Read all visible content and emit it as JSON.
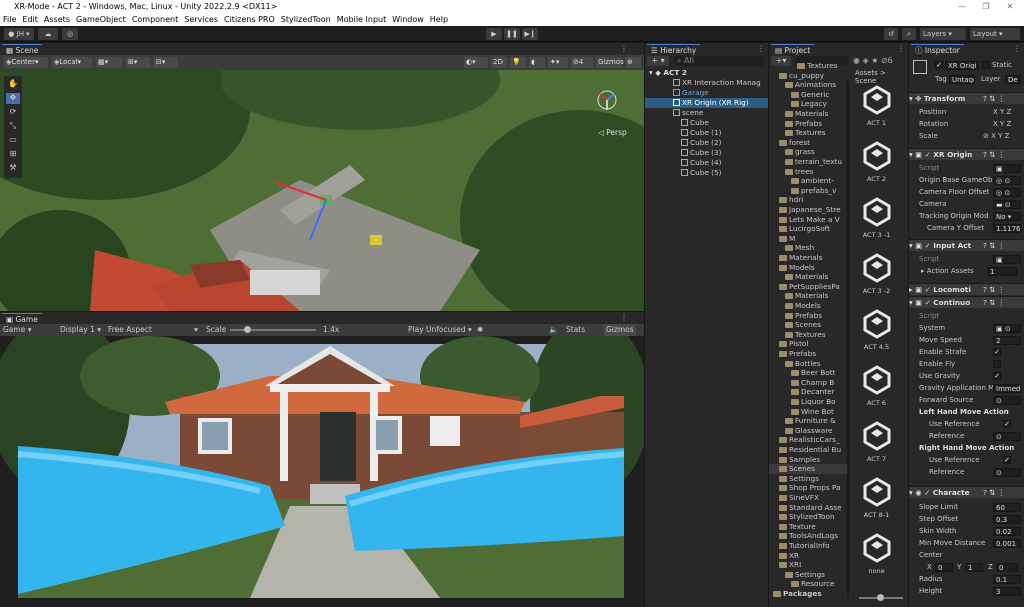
{
  "window": {
    "title": "XR-Mode - ACT 2 - Windows, Mac, Linux - Unity 2022.2.9 <DX11>"
  },
  "menu": [
    "File",
    "Edit",
    "Assets",
    "GameObject",
    "Component",
    "Services",
    "Citizens PRO",
    "StylizedToon",
    "Mobile Input",
    "Window",
    "Help"
  ],
  "toolbar": {
    "account": "JH",
    "layers": "Layers",
    "layout": "Layout"
  },
  "scene": {
    "tab": "Scene",
    "pivot": "Center",
    "space": "Local",
    "mode2d": "2D",
    "persp": "Persp",
    "gizmos": "Gizmos"
  },
  "game": {
    "tab": "Game",
    "view": "Game",
    "display": "Display 1",
    "aspect": "Free Aspect",
    "scale_label": "Scale",
    "scale_value": "1.4x",
    "play_mode": "Play Unfocused",
    "stats": "Stats",
    "gizmos": "Gizmos"
  },
  "hierarchy": {
    "tab": "Hierarchy",
    "search": "All",
    "items": [
      "ACT 2",
      "XR Interaction Manag",
      "Garage",
      "XR Origin (XR Rig)",
      "scene",
      "Cube",
      "Cube (1)",
      "Cube (2)",
      "Cube (3)",
      "Cube (4)",
      "Cube (5)"
    ]
  },
  "project": {
    "tab": "Project",
    "breadcrumb": "Assets > Scene",
    "tree": [
      "Textures",
      "cu_puppy",
      "Animations",
      "Generic",
      "Legacy",
      "Materials",
      "Prefabs",
      "Textures",
      "forest",
      "grass",
      "terrain_textu",
      "trees",
      "ambient-",
      "prefabs_v",
      "hdri",
      "Japanese_Stre",
      "Lets Make a V",
      "LucirgoSoft",
      "M",
      "Mesh",
      "Materials",
      "Models",
      "Materials",
      "PetSuppliesPa",
      "Materials",
      "Models",
      "Prefabs",
      "Scenes",
      "Textures",
      "Pistol",
      "Prefabs",
      "Bottles",
      "Beer Bott",
      "Champ B",
      "Decanter",
      "Liquor Bo",
      "Wine Bot",
      "Furniture &",
      "Glassware",
      "RealisticCars_",
      "Residential Bu",
      "Samples",
      "Scenes",
      "Settings",
      "Shop Props Pa",
      "SineVFX",
      "Standard Asse",
      "StylizedToon",
      "Texture",
      "ToolsAndLogs",
      "TutorialInfo",
      "XR",
      "XRI",
      "Settings",
      "Resource",
      "Packages"
    ],
    "assets": [
      "ACT 1",
      "ACT 2",
      "ACT 3 -1",
      "ACT 3 -2",
      "ACT 4,5",
      "ACT 6",
      "ACT 7",
      "ACT 8-1",
      "none"
    ]
  },
  "inspector": {
    "tab": "Inspector",
    "object_name": "XR Origi",
    "static": "Static",
    "tag_label": "Tag",
    "tag": "Untagg",
    "layer_label": "Layer",
    "layer": "De",
    "transform": {
      "title": "Transform",
      "position": "Position",
      "rotation": "Rotation",
      "scale": "Scale"
    },
    "xr_origin": {
      "title": "XR Origin",
      "script": "Script",
      "origin_base": "Origin Base GameOb",
      "camera_floor": "Camera Floor Offset",
      "camera": "Camera",
      "tracking_label": "Tracking Origin Mod",
      "tracking_value": "No",
      "cam_y_label": "Camera Y Offset",
      "cam_y_value": "1.1176"
    },
    "input_action": {
      "title": "Input Act",
      "script": "Script",
      "action_assets": "Action Assets",
      "action_assets_value": "1"
    },
    "locomotion": {
      "title": "Locomoti"
    },
    "continuous": {
      "title": "Continuo",
      "script": "Script",
      "system": "System",
      "move_speed": "Move Speed",
      "move_speed_value": "2",
      "enable_strafe": "Enable Strafe",
      "enable_fly": "Enable Fly",
      "use_gravity": "Use Gravity",
      "gravity_app": "Gravity Application M",
      "gravity_app_value": "Immed",
      "forward_source": "Forward Source",
      "left_hand": "Left Hand Move Action",
      "use_ref": "Use Reference",
      "reference": "Reference",
      "right_hand": "Right Hand Move Action"
    },
    "character": {
      "title": "Characte",
      "slope": "Slope Limit",
      "slope_value": "60",
      "step": "Step Offset",
      "step_value": "0.3",
      "skin": "Skin Width",
      "skin_value": "0.02",
      "min_move": "Min Move Distance",
      "min_move_value": "0.001",
      "center": "Center",
      "cx": "0",
      "cy": "1",
      "cz": "0",
      "radius": "Radius",
      "radius_value": "0.1",
      "height": "Height",
      "height_value": "3"
    }
  }
}
